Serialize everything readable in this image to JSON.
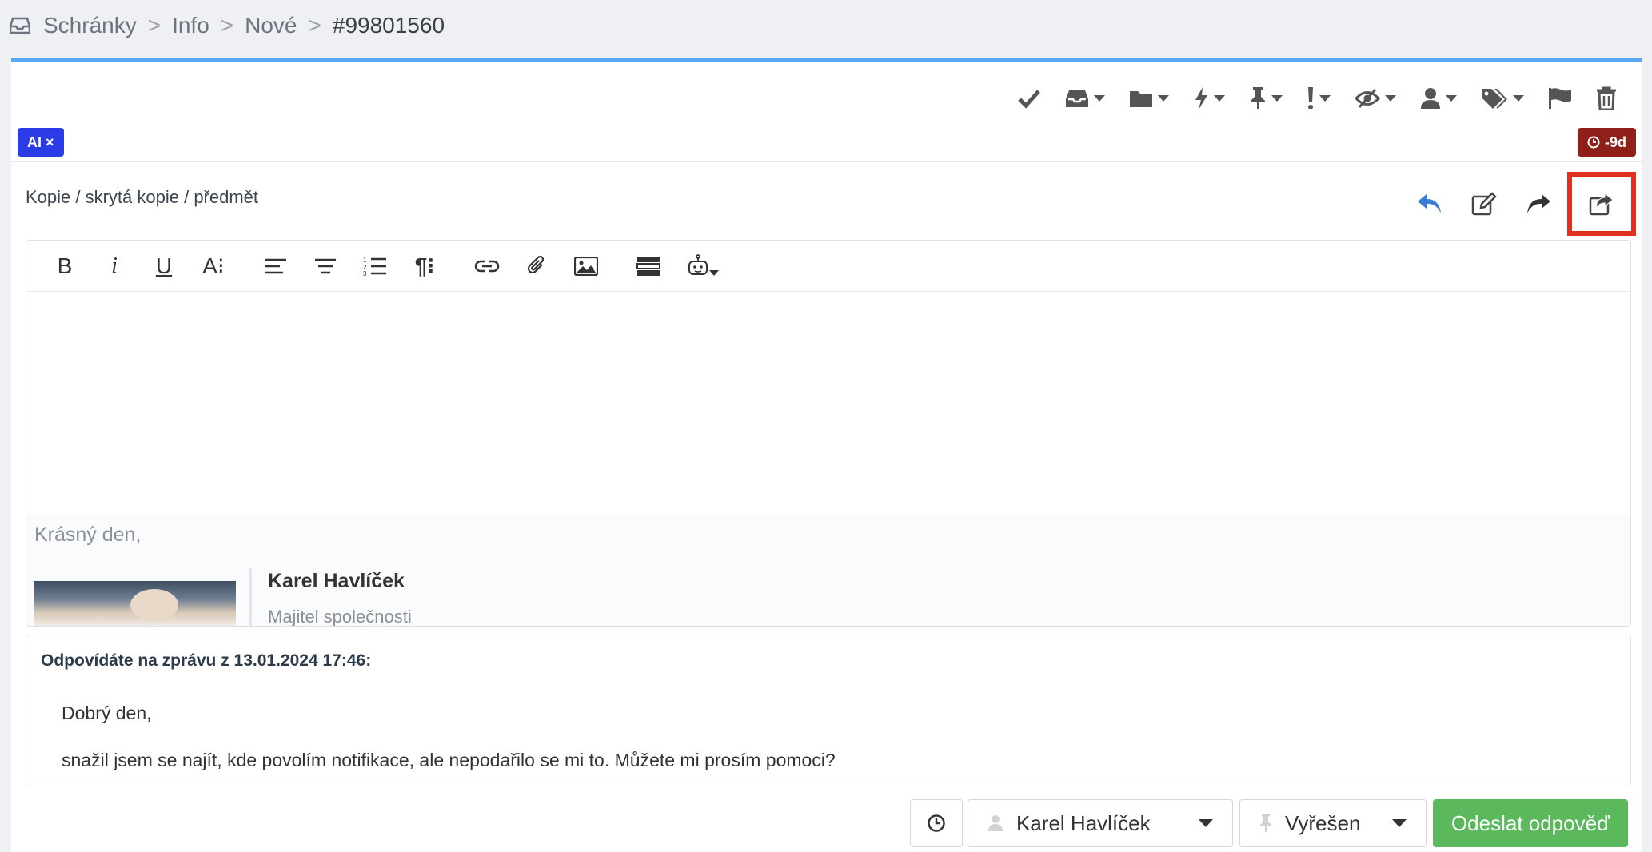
{
  "breadcrumb": {
    "items": [
      "Schránky",
      "Info",
      "Nové"
    ],
    "separator": ">",
    "current": "#99801560"
  },
  "toolbar": {
    "actions": [
      {
        "name": "resolve-check-icon"
      },
      {
        "name": "inbox-icon",
        "dropdown": true
      },
      {
        "name": "folder-icon",
        "dropdown": true
      },
      {
        "name": "bolt-icon",
        "dropdown": true
      },
      {
        "name": "pin-icon",
        "dropdown": true
      },
      {
        "name": "priority-icon",
        "dropdown": true
      },
      {
        "name": "eye-slash-icon",
        "dropdown": true
      },
      {
        "name": "user-icon",
        "dropdown": true
      },
      {
        "name": "tags-icon",
        "dropdown": true
      },
      {
        "name": "flag-icon"
      },
      {
        "name": "trash-icon"
      }
    ]
  },
  "badges": {
    "ai": "AI ×",
    "due": "-9d"
  },
  "compose": {
    "cc_link": "Kopie / skrytá kopie / předmět",
    "modes": [
      "reply-icon",
      "note-icon",
      "forward-icon",
      "share-icon"
    ]
  },
  "editor": {
    "toolbar": [
      "B",
      "i",
      "U",
      "A⁝"
    ],
    "signature": {
      "greeting": "Krásný den,",
      "name": "Karel Havlíček",
      "role": "Majitel společnosti"
    }
  },
  "quote": {
    "header": "Odpovídáte na zprávu z 13.01.2024 17:46:",
    "line1": "Dobrý den,",
    "line2": "snažil jsem se najít, kde povolím notifikace, ale nepodařilo se mi to. Můžete mi prosím pomoci?"
  },
  "footer": {
    "agent": "Karel Havlíček",
    "status": "Vyřešen",
    "send": "Odeslat odpověď"
  },
  "colors": {
    "accent_bar": "#5aa9f0",
    "ai_badge": "#2b3be6",
    "due_badge": "#8e1f19",
    "send_button": "#5cb85c",
    "highlight": "#e0301e",
    "reply_icon": "#3a7bd5"
  }
}
